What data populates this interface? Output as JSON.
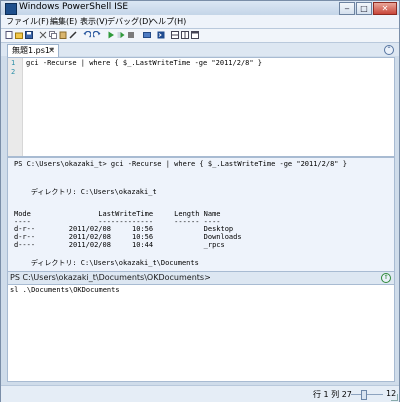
{
  "window": {
    "title": "Windows PowerShell ISE",
    "buttons": [
      "‒",
      "□",
      "✕"
    ]
  },
  "menu": [
    "ファイル(F)",
    "編集(E)",
    "表示(V)",
    "デバッグ(D)",
    "ヘルプ(H)"
  ],
  "toolbar_icons": [
    "new-icon",
    "open-icon",
    "save-icon",
    "cut-icon",
    "copy-icon",
    "paste-icon",
    "clear-icon",
    "undo-icon",
    "redo-icon",
    "run-icon",
    "run-selection-icon",
    "stop-icon",
    "new-remote-tab-icon",
    "start-powershell-icon",
    "layout-top-icon",
    "layout-right-icon",
    "layout-maximize-icon"
  ],
  "tab": {
    "label": "無題1.ps1*",
    "close": "✕"
  },
  "editor": {
    "lines": [
      {
        "number": "1",
        "text": "gci -Recurse | where { $_.LastWriteTime -ge \"2011/2/8\" }"
      },
      {
        "number": "2",
        "text": ""
      }
    ]
  },
  "output": {
    "lines": [
      "PS C:\\Users\\okazaki_t> gci -Recurse | where { $_.LastWriteTime -ge \"2011/2/8\" }",
      "",
      "",
      "    ディレクトリ: C:\\Users\\okazaki_t",
      "",
      "",
      "Mode                LastWriteTime     Length Name",
      "----                -------------     ------ ----",
      "d-r--        2011/02/08     10:56            Desktop",
      "d-r--        2011/02/08     10:56            Downloads",
      "d----        2011/02/08     10:44            _rpcs",
      "",
      "",
      "    ディレクトリ: C:\\Users\\okazaki_t\\Documents"
    ]
  },
  "command": {
    "prompt": "PS C:\\Users\\okazaki_t\\Documents\\OKDocuments>",
    "input": "sl .\\Documents\\OKDocuments"
  },
  "status": {
    "position": "行 1 列 27",
    "zoom": "12"
  },
  "colors": {
    "cmdlet": "#0000ff",
    "string": "#8b0000",
    "variable": "#ff4500",
    "operator": "#a9a9a9"
  }
}
